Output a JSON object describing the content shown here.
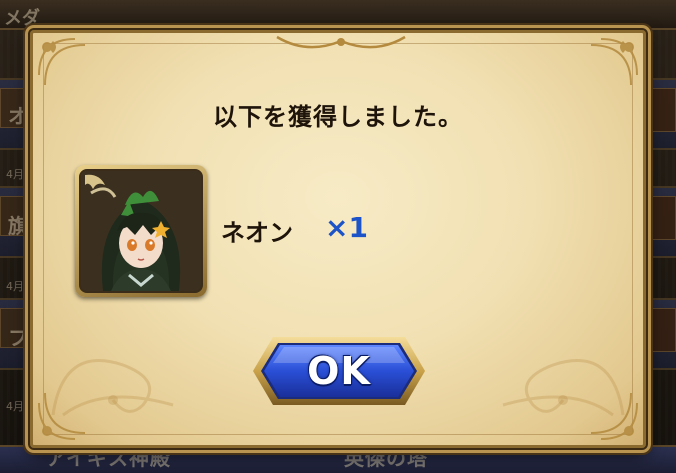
{
  "dialog": {
    "title": "以下を獲得しました。"
  },
  "reward": {
    "name": "ネオン",
    "quantity": "×1",
    "icon": "character-portrait-icon"
  },
  "buttons": {
    "ok_label": "OK"
  },
  "background": {
    "top_left_text": "メダ",
    "row_glyphs": [
      "オ",
      "旗",
      "フ"
    ],
    "row_dates": [
      "4月",
      "4月",
      "4月"
    ],
    "bottom_left_text": "アイギス神殿",
    "bottom_right_text": "英傑の塔"
  },
  "colors": {
    "quantity_text": "#1d53c9",
    "button_fill": "#2a4fd6",
    "button_border": "#c9a24a",
    "panel": "#f1e0b2"
  }
}
